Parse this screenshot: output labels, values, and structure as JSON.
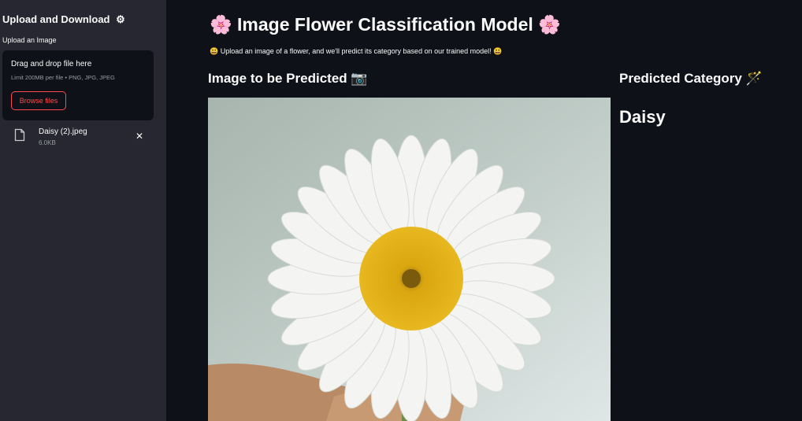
{
  "sidebar": {
    "title": "Upload and Download",
    "title_icon": "gear-icon",
    "upload_label": "Upload an Image",
    "dropzone": {
      "text": "Drag and drop file here",
      "limit": "Limit 200MB per file • PNG, JPG, JPEG",
      "browse_label": "Browse files"
    },
    "file": {
      "name": "Daisy (2).jpeg",
      "size": "6.0KB"
    }
  },
  "main": {
    "title": "🌸 Image Flower Classification Model 🌸",
    "subtitle": "😃 Upload an image of a flower, and we'll predict its category based on our trained model! 😃",
    "image_heading": "Image to be Predicted 📷",
    "prediction_heading": "Predicted Category 🪄",
    "prediction_value": "Daisy"
  },
  "colors": {
    "background": "#0e1117",
    "sidebar": "#262730",
    "accent": "#ff4b4b"
  }
}
